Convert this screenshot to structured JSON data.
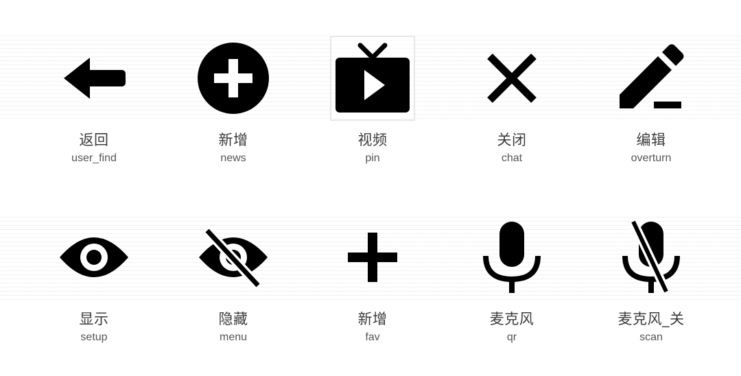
{
  "colors": {
    "icon": "#000000",
    "label_cn": "#3c3c3c",
    "label_en": "#555555",
    "grid": "#e8e8e8"
  },
  "icons": [
    {
      "icon_name": "arrow-left-icon",
      "label_cn": "返回",
      "label_en": "user_find"
    },
    {
      "icon_name": "plus-circle-icon",
      "label_cn": "新增",
      "label_en": "news"
    },
    {
      "icon_name": "tv-play-icon",
      "label_cn": "视频",
      "label_en": "pin",
      "selected": true
    },
    {
      "icon_name": "close-icon",
      "label_cn": "关闭",
      "label_en": "chat"
    },
    {
      "icon_name": "pencil-icon",
      "label_cn": "编辑",
      "label_en": "overturn"
    },
    {
      "icon_name": "eye-icon",
      "label_cn": "显示",
      "label_en": "setup"
    },
    {
      "icon_name": "eye-off-icon",
      "label_cn": "隐藏",
      "label_en": "menu"
    },
    {
      "icon_name": "plus-icon",
      "label_cn": "新增",
      "label_en": "fav"
    },
    {
      "icon_name": "microphone-icon",
      "label_cn": "麦克风",
      "label_en": "qr"
    },
    {
      "icon_name": "microphone-off-icon",
      "label_cn": "麦克风_关",
      "label_en": "scan"
    }
  ]
}
